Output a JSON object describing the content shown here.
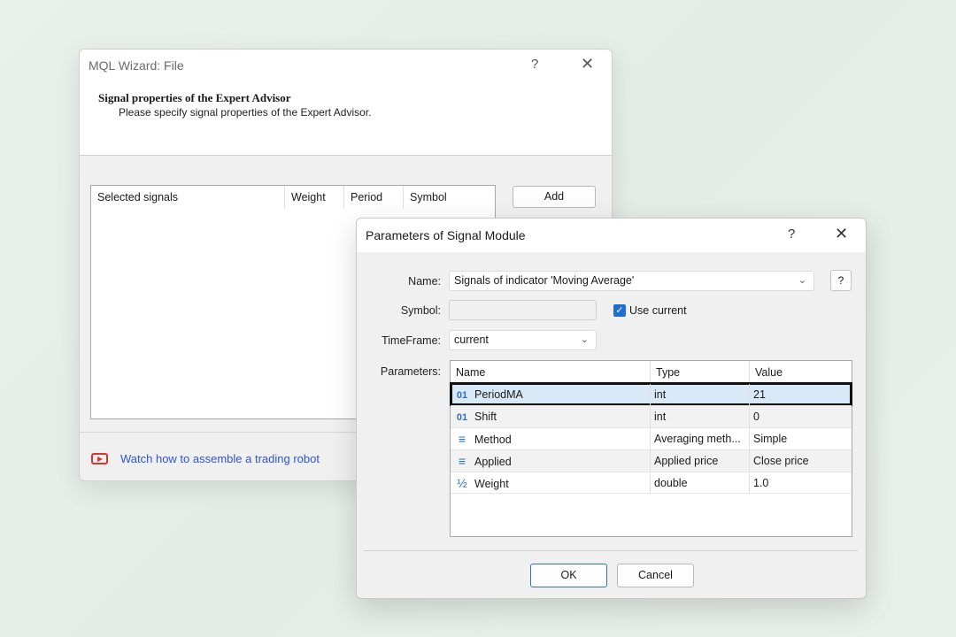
{
  "wizard": {
    "title": "MQL Wizard: File",
    "help_glyph": "?",
    "close_glyph": "✕",
    "header_title": "Signal properties of the Expert Advisor",
    "header_subtitle": "Please specify signal properties of the Expert Advisor.",
    "signals_columns": [
      "Selected signals",
      "Weight",
      "Period",
      "Symbol"
    ],
    "add_label": "Add",
    "watch_link": "Watch how to assemble a trading robot",
    "accent_color": "#2f54d6"
  },
  "params": {
    "title": "Parameters of Signal Module",
    "help_glyph": "?",
    "close_glyph": "✕",
    "name_label": "Name:",
    "name_value": "Signals of indicator 'Moving Average'",
    "name_help": "?",
    "symbol_label": "Symbol:",
    "symbol_value": "",
    "use_current_label": "Use current",
    "use_current_checked": true,
    "timeframe_label": "TimeFrame:",
    "timeframe_value": "current",
    "parameters_label": "Parameters:",
    "grid_columns": [
      "Name",
      "Type",
      "Value"
    ],
    "rows": [
      {
        "icon": "01",
        "name": "PeriodMA",
        "type": "int",
        "value": "21"
      },
      {
        "icon": "01",
        "name": "Shift",
        "type": "int",
        "value": "0"
      },
      {
        "icon": "≡",
        "name": "Method",
        "type": "Averaging meth...",
        "value": "Simple"
      },
      {
        "icon": "≡",
        "name": "Applied",
        "type": "Applied price",
        "value": "Close price"
      },
      {
        "icon": "½",
        "name": "Weight",
        "type": "double",
        "value": "1.0"
      }
    ],
    "ok_label": "OK",
    "cancel_label": "Cancel",
    "checkbox_color": "#1f6fd0"
  }
}
